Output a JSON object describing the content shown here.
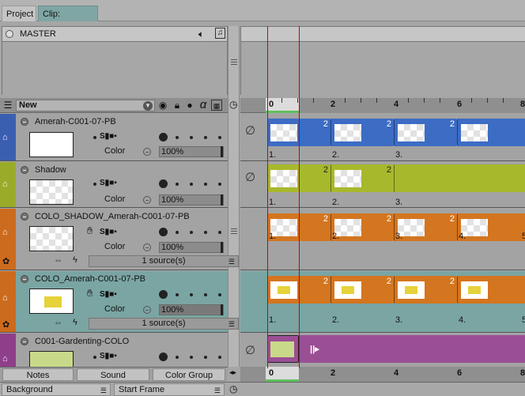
{
  "tabs": [
    "Project",
    "Clip: Timeline"
  ],
  "master": {
    "label": "MASTER"
  },
  "header": {
    "layer_select": "New",
    "alpha_symbol": "α"
  },
  "layers": [
    {
      "name": "Amerah-C001-07-PB",
      "color_label": "Color",
      "opacity": "100%",
      "stripe": "#3b5fb0"
    },
    {
      "name": "Shadow",
      "color_label": "Color",
      "opacity": "100%",
      "stripe": "#9aab2a"
    },
    {
      "name": "COLO_SHADOW_Amerah-C001-07-PB",
      "color_label": "Color",
      "opacity": "100%",
      "sources": "1 source(s)",
      "stripe": "#cc6b1e"
    },
    {
      "name": "COLO_Amerah-C001-07-PB",
      "color_label": "Color",
      "opacity": "100%",
      "sources": "1 source(s)",
      "stripe": "#cc6b1e"
    },
    {
      "name": "C001-Gardenting-COLO",
      "stripe": "#8e3f8a"
    }
  ],
  "ruler": {
    "labels": [
      "0",
      "2",
      "4",
      "6",
      "8"
    ],
    "bottom_labels": [
      "0",
      "2",
      "4",
      "6",
      "8"
    ]
  },
  "cells": {
    "cell_count": "2",
    "frame_labels": [
      "1.",
      "2.",
      "3.",
      "4.",
      "5"
    ]
  },
  "bottom_tabs": [
    "Notes",
    "Sound",
    "Color Group"
  ],
  "bottom_bar": {
    "background": "Background",
    "start_frame": "Start Frame"
  },
  "colors": {
    "blue_cell": "#3c6cc4",
    "green_cell": "#a8b82c",
    "orange_cell": "#d4751f",
    "purple_cell": "#9a4f95",
    "teal_layer": "#7aa5a3"
  }
}
